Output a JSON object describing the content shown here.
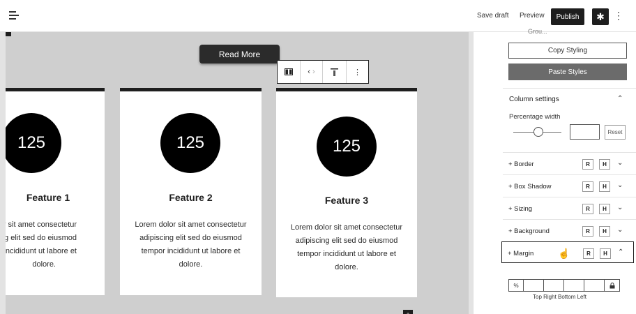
{
  "header": {
    "menu_icon": "hamburger-menu-icon",
    "save_draft": "Save draft",
    "preview": "Preview",
    "publish": "Publish",
    "settings_icon": "gear-icon",
    "more_icon": "vertical-ellipsis-icon"
  },
  "canvas": {
    "read_more": "Read More",
    "toolbar": {
      "column_icon": "columns-icon",
      "move_left": "‹",
      "move_right": "›",
      "align_icon": "align-top-icon",
      "more_icon": "⋮"
    },
    "cards": [
      {
        "number": "125",
        "title": "Feature 1",
        "lines": [
          "olor sit amet consectetur",
          "cing elit sed do eiusmod",
          "r incididunt ut labore et",
          "dolore."
        ]
      },
      {
        "number": "125",
        "title": "Feature 2",
        "lines": [
          "Lorem dolor sit amet consectetur",
          "adipiscing elit sed do eiusmod",
          "tempor incididunt ut labore et",
          "dolore."
        ]
      },
      {
        "number": "125",
        "title": "Feature 3",
        "lines": [
          "Lorem dolor sit amet consectetur",
          "adipiscing elit sed do eiusmod",
          "tempor incididunt ut labore et",
          "dolore."
        ]
      }
    ]
  },
  "sidebar": {
    "clipped_label": "Grou...",
    "copy_styling": "Copy Styling",
    "paste_styles": "Paste Styles",
    "column_settings": "Column settings",
    "percentage_width": "Percentage width",
    "percentage_value": "",
    "reset": "Reset",
    "sections": [
      {
        "label": "+ Border",
        "r": "R",
        "h": "H",
        "chevron": "⌄"
      },
      {
        "label": "+ Box Shadow",
        "r": "R",
        "h": "H",
        "chevron": "⌄"
      },
      {
        "label": "+ Sizing",
        "r": "R",
        "h": "H",
        "chevron": "⌄"
      },
      {
        "label": "+ Background",
        "r": "R",
        "h": "H",
        "chevron": "⌄"
      },
      {
        "label": "+ Margin",
        "r": "R",
        "h": "H",
        "chevron": "⌃"
      }
    ],
    "margin": {
      "unit": "%",
      "lock_icon": "lock-icon",
      "labels": "Top  Right Bottom  Left"
    }
  }
}
